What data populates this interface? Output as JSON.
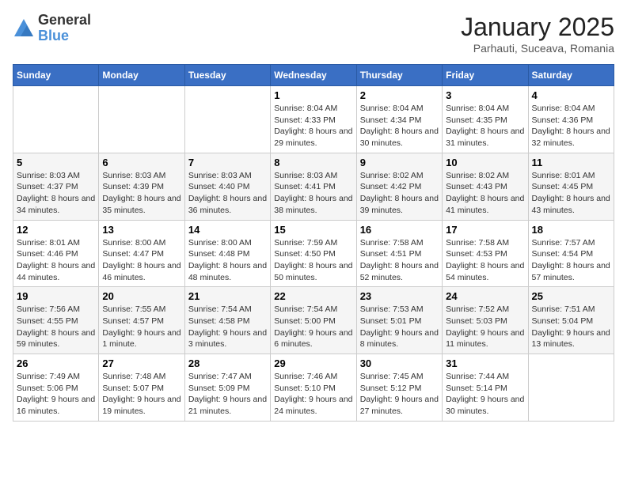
{
  "logo": {
    "general": "General",
    "blue": "Blue"
  },
  "title": "January 2025",
  "subtitle": "Parhauti, Suceava, Romania",
  "days_of_week": [
    "Sunday",
    "Monday",
    "Tuesday",
    "Wednesday",
    "Thursday",
    "Friday",
    "Saturday"
  ],
  "weeks": [
    [
      {
        "day": "",
        "info": ""
      },
      {
        "day": "",
        "info": ""
      },
      {
        "day": "",
        "info": ""
      },
      {
        "day": "1",
        "info": "Sunrise: 8:04 AM\nSunset: 4:33 PM\nDaylight: 8 hours and 29 minutes."
      },
      {
        "day": "2",
        "info": "Sunrise: 8:04 AM\nSunset: 4:34 PM\nDaylight: 8 hours and 30 minutes."
      },
      {
        "day": "3",
        "info": "Sunrise: 8:04 AM\nSunset: 4:35 PM\nDaylight: 8 hours and 31 minutes."
      },
      {
        "day": "4",
        "info": "Sunrise: 8:04 AM\nSunset: 4:36 PM\nDaylight: 8 hours and 32 minutes."
      }
    ],
    [
      {
        "day": "5",
        "info": "Sunrise: 8:03 AM\nSunset: 4:37 PM\nDaylight: 8 hours and 34 minutes."
      },
      {
        "day": "6",
        "info": "Sunrise: 8:03 AM\nSunset: 4:39 PM\nDaylight: 8 hours and 35 minutes."
      },
      {
        "day": "7",
        "info": "Sunrise: 8:03 AM\nSunset: 4:40 PM\nDaylight: 8 hours and 36 minutes."
      },
      {
        "day": "8",
        "info": "Sunrise: 8:03 AM\nSunset: 4:41 PM\nDaylight: 8 hours and 38 minutes."
      },
      {
        "day": "9",
        "info": "Sunrise: 8:02 AM\nSunset: 4:42 PM\nDaylight: 8 hours and 39 minutes."
      },
      {
        "day": "10",
        "info": "Sunrise: 8:02 AM\nSunset: 4:43 PM\nDaylight: 8 hours and 41 minutes."
      },
      {
        "day": "11",
        "info": "Sunrise: 8:01 AM\nSunset: 4:45 PM\nDaylight: 8 hours and 43 minutes."
      }
    ],
    [
      {
        "day": "12",
        "info": "Sunrise: 8:01 AM\nSunset: 4:46 PM\nDaylight: 8 hours and 44 minutes."
      },
      {
        "day": "13",
        "info": "Sunrise: 8:00 AM\nSunset: 4:47 PM\nDaylight: 8 hours and 46 minutes."
      },
      {
        "day": "14",
        "info": "Sunrise: 8:00 AM\nSunset: 4:48 PM\nDaylight: 8 hours and 48 minutes."
      },
      {
        "day": "15",
        "info": "Sunrise: 7:59 AM\nSunset: 4:50 PM\nDaylight: 8 hours and 50 minutes."
      },
      {
        "day": "16",
        "info": "Sunrise: 7:58 AM\nSunset: 4:51 PM\nDaylight: 8 hours and 52 minutes."
      },
      {
        "day": "17",
        "info": "Sunrise: 7:58 AM\nSunset: 4:53 PM\nDaylight: 8 hours and 54 minutes."
      },
      {
        "day": "18",
        "info": "Sunrise: 7:57 AM\nSunset: 4:54 PM\nDaylight: 8 hours and 57 minutes."
      }
    ],
    [
      {
        "day": "19",
        "info": "Sunrise: 7:56 AM\nSunset: 4:55 PM\nDaylight: 8 hours and 59 minutes."
      },
      {
        "day": "20",
        "info": "Sunrise: 7:55 AM\nSunset: 4:57 PM\nDaylight: 9 hours and 1 minute."
      },
      {
        "day": "21",
        "info": "Sunrise: 7:54 AM\nSunset: 4:58 PM\nDaylight: 9 hours and 3 minutes."
      },
      {
        "day": "22",
        "info": "Sunrise: 7:54 AM\nSunset: 5:00 PM\nDaylight: 9 hours and 6 minutes."
      },
      {
        "day": "23",
        "info": "Sunrise: 7:53 AM\nSunset: 5:01 PM\nDaylight: 9 hours and 8 minutes."
      },
      {
        "day": "24",
        "info": "Sunrise: 7:52 AM\nSunset: 5:03 PM\nDaylight: 9 hours and 11 minutes."
      },
      {
        "day": "25",
        "info": "Sunrise: 7:51 AM\nSunset: 5:04 PM\nDaylight: 9 hours and 13 minutes."
      }
    ],
    [
      {
        "day": "26",
        "info": "Sunrise: 7:49 AM\nSunset: 5:06 PM\nDaylight: 9 hours and 16 minutes."
      },
      {
        "day": "27",
        "info": "Sunrise: 7:48 AM\nSunset: 5:07 PM\nDaylight: 9 hours and 19 minutes."
      },
      {
        "day": "28",
        "info": "Sunrise: 7:47 AM\nSunset: 5:09 PM\nDaylight: 9 hours and 21 minutes."
      },
      {
        "day": "29",
        "info": "Sunrise: 7:46 AM\nSunset: 5:10 PM\nDaylight: 9 hours and 24 minutes."
      },
      {
        "day": "30",
        "info": "Sunrise: 7:45 AM\nSunset: 5:12 PM\nDaylight: 9 hours and 27 minutes."
      },
      {
        "day": "31",
        "info": "Sunrise: 7:44 AM\nSunset: 5:14 PM\nDaylight: 9 hours and 30 minutes."
      },
      {
        "day": "",
        "info": ""
      }
    ]
  ]
}
